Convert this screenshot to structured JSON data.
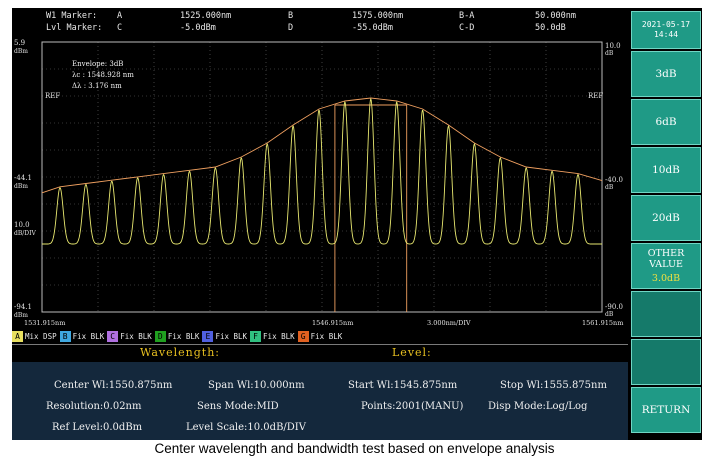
{
  "markers": {
    "w1_label": "W1 Marker:",
    "lvl_label": "Lvl Marker:",
    "a_name": "A",
    "a_value": "1525.000nm",
    "b_name": "B",
    "b_value": "1575.000nm",
    "ba_name": "B-A",
    "ba_value": "50.000nm",
    "c_name": "C",
    "c_value": "-5.0dBm",
    "d_name": "D",
    "d_value": "-55.0dBm",
    "cd_name": "C-D",
    "cd_value": "50.0dB"
  },
  "plot": {
    "left_top": "5.9",
    "left_top_unit": "dBm",
    "left_mid": "-44.1",
    "left_mid_unit": "dBm",
    "left_scale": "10.0",
    "left_scale_unit": "dB/DIV",
    "left_bot": "-94.1",
    "left_bot_unit": "dBm",
    "right_top": "10.0",
    "right_top_unit": "dB",
    "right_mid": "-40.0",
    "right_mid_unit": "dB",
    "right_bot": "-90.0",
    "right_bot_unit": "dB",
    "ref_left": "REF",
    "ref_right": "REF",
    "x_left": "1531.915nm",
    "x_center": "1546.915nm",
    "x_div": "3.000nm/DIV",
    "x_right": "1561.915nm",
    "annot_line1": "Envelope: 3dB",
    "annot_line2": "λc  : 1548.928 nm",
    "annot_line3": "Δλ  : 3.176 nm",
    "colors": {
      "trace": "#e8e870",
      "envelope": "#f0a060",
      "grid": "#6a6a6a",
      "frame": "#bdbdbd"
    }
  },
  "traces": [
    {
      "letter": "A",
      "mode": "Mix",
      "state": "DSP",
      "color": "#e8e060"
    },
    {
      "letter": "B",
      "mode": "Fix",
      "state": "BLK",
      "color": "#3fa8e0"
    },
    {
      "letter": "C",
      "mode": "Fix",
      "state": "BLK",
      "color": "#b070e0"
    },
    {
      "letter": "D",
      "mode": "Fix",
      "state": "BLK",
      "color": "#20a020"
    },
    {
      "letter": "E",
      "mode": "Fix",
      "state": "BLK",
      "color": "#5060e0"
    },
    {
      "letter": "F",
      "mode": "Fix",
      "state": "BLK",
      "color": "#30c080"
    },
    {
      "letter": "G",
      "mode": "Fix",
      "state": "BLK",
      "color": "#e06020"
    }
  ],
  "bars": {
    "wavelength": "Wavelength:",
    "level": "Level:"
  },
  "status": {
    "center": "Center Wl:1550.875nm",
    "span": "Span Wl:10.000nm",
    "start": "Start Wl:1545.875nm",
    "stop": "Stop Wl:1555.875nm",
    "resolution": "Resolution:0.02nm",
    "sens": "Sens Mode:MID",
    "points": "Points:2001(MANU)",
    "disp": "Disp Mode:Log/Log",
    "ref": "Ref Level:0.0dBm",
    "scale": "Level Scale:10.0dB/DIV"
  },
  "panel": {
    "date": "2021-05-17",
    "time": "14:44",
    "btn_3db": "3dB",
    "btn_6db": "6dB",
    "btn_10db": "10dB",
    "btn_20db": "20dB",
    "other_label": "OTHER VALUE",
    "other_value": "3.0dB",
    "return_label": "RETURN"
  },
  "caption": "Center wavelength and bandwidth test based on envelope analysis"
}
